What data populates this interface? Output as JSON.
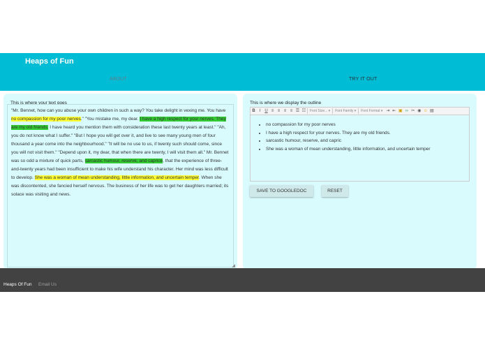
{
  "header": {
    "brand": "Heaps of Fun",
    "tabs": [
      {
        "label": "ABOUT"
      },
      {
        "label": "TRY IT OUT"
      }
    ]
  },
  "left_panel": {
    "label": "This is where your text goes",
    "text_segments": [
      {
        "text": "\"Mr. Bennet, how can you abuse your own children in such a way? You take delight in vexing me. You have ",
        "highlight": "none"
      },
      {
        "text": "no compassion for my poor nerves",
        "highlight": "yellow"
      },
      {
        "text": ".\" \"You mistake me, my dear. ",
        "highlight": "none"
      },
      {
        "text": "I have a high respect for your nerves. They are my old friends.",
        "highlight": "green"
      },
      {
        "text": " I have heard you mention them with consideration these last twenty years at least.\" \"Ah, you do not know what I suffer.\" \"But I hope you will get over it, and live to see many young men of four thousand a year come into the neighbourhood.\" \"It will be no use to us, if twenty such should come, since you will not visit them.\" \"Depend upon it, my dear, that when there are twenty, I will visit them all.\" Mr. Bennet was so odd a mixture of quick parts, ",
        "highlight": "none"
      },
      {
        "text": "sarcastic humour, reserve, and caprice",
        "highlight": "green"
      },
      {
        "text": ", that the experience of three-and-twenty years had been insufficient to make his wife understand his character. Her mind was less difficult to develop. ",
        "highlight": "none"
      },
      {
        "text": "She was a woman of mean understanding, little information, and uncertain temper",
        "highlight": "yellow"
      },
      {
        "text": ". When she was discontented, she fancied herself nervous. The business of her life was to get her daughters married; its solace was visiting and news.",
        "highlight": "none"
      }
    ]
  },
  "right_panel": {
    "label": "This is where we display the outline",
    "toolbar": {
      "buttons": [
        "B",
        "I",
        "U"
      ],
      "font_size": "Font Size...",
      "font_family": "Font Family",
      "font_format": "Font Format"
    },
    "outline": [
      "no compassion for my poor nerves",
      "I have a high respect for your nerves. They are my old friends.",
      "sarcastic humour, reserve, and capric",
      "She was a woman of mean understanding, little information, and uncertain temper"
    ],
    "save_label": "SAVE TO GOOGLEDOC",
    "reset_label": "RESET"
  },
  "footer": {
    "brand": "Heaps Of Fun",
    "link": "Email Us"
  },
  "colors": {
    "header": "#00bcd4",
    "panel": "#d9fbfe",
    "footer": "#424242",
    "highlight_yellow": "#ffff33",
    "highlight_green": "#33cc33"
  }
}
